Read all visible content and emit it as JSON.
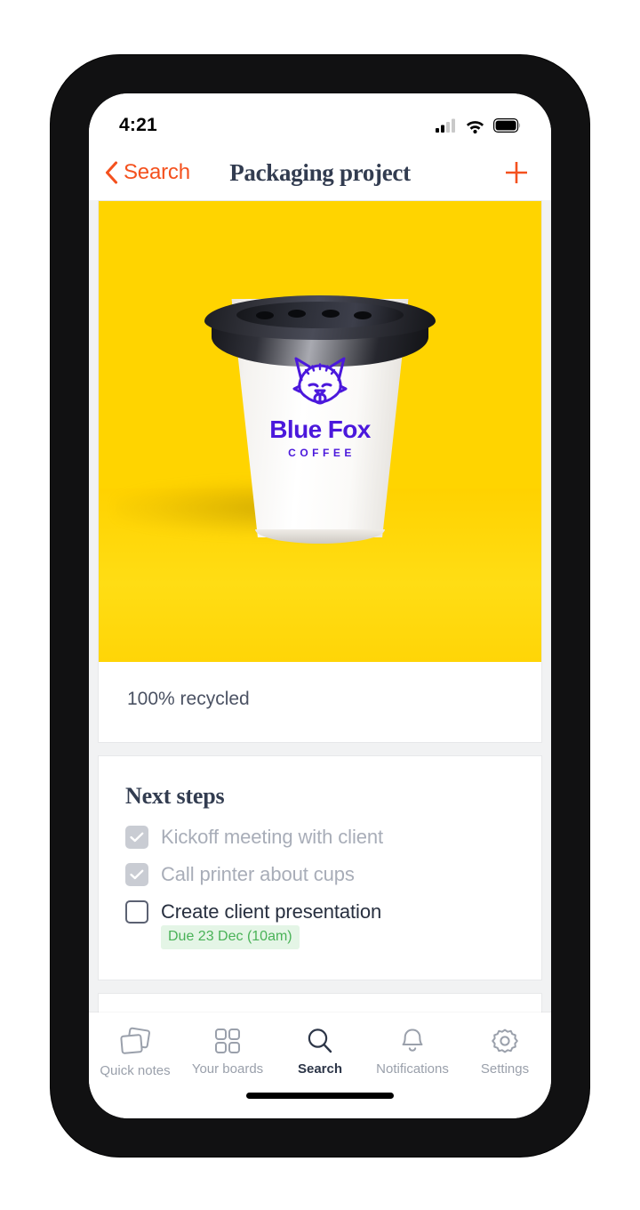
{
  "status_bar": {
    "time": "4:21",
    "icons": [
      "cellular-signal-icon",
      "wifi-icon",
      "battery-icon"
    ]
  },
  "nav": {
    "back_label": "Search",
    "back_icon": "chevron-left-icon",
    "title": "Packaging project",
    "add_icon": "plus-icon",
    "accent_color": "#F4511E",
    "title_color": "#323C50"
  },
  "photo_card": {
    "image_alt": "Blue Fox Coffee paper cup on yellow background",
    "background_color": "#FFD400",
    "logo": {
      "mark": "fox-head-icon",
      "name": "Blue Fox",
      "subtitle": "COFFEE",
      "color": "#4B18DC"
    },
    "caption": "100% recycled"
  },
  "next_steps": {
    "title": "Next steps",
    "items": [
      {
        "label": "Kickoff meeting with client",
        "checked": true,
        "due": null
      },
      {
        "label": "Call printer about cups",
        "checked": true,
        "due": null
      },
      {
        "label": "Create client presentation",
        "checked": false,
        "due": "Due 23 Dec (10am)"
      }
    ],
    "due_badge_bg": "#E4F5E6",
    "due_badge_color": "#49B257"
  },
  "tabbar": {
    "items": [
      {
        "label": "Quick notes",
        "icon": "notes-stack-icon",
        "active": false
      },
      {
        "label": "Your boards",
        "icon": "grid-boards-icon",
        "active": false
      },
      {
        "label": "Search",
        "icon": "search-icon",
        "active": true
      },
      {
        "label": "Notifications",
        "icon": "bell-icon",
        "active": false
      },
      {
        "label": "Settings",
        "icon": "gear-icon",
        "active": false
      }
    ],
    "active_color": "#2D3648",
    "inactive_color": "#9AA0AB"
  }
}
